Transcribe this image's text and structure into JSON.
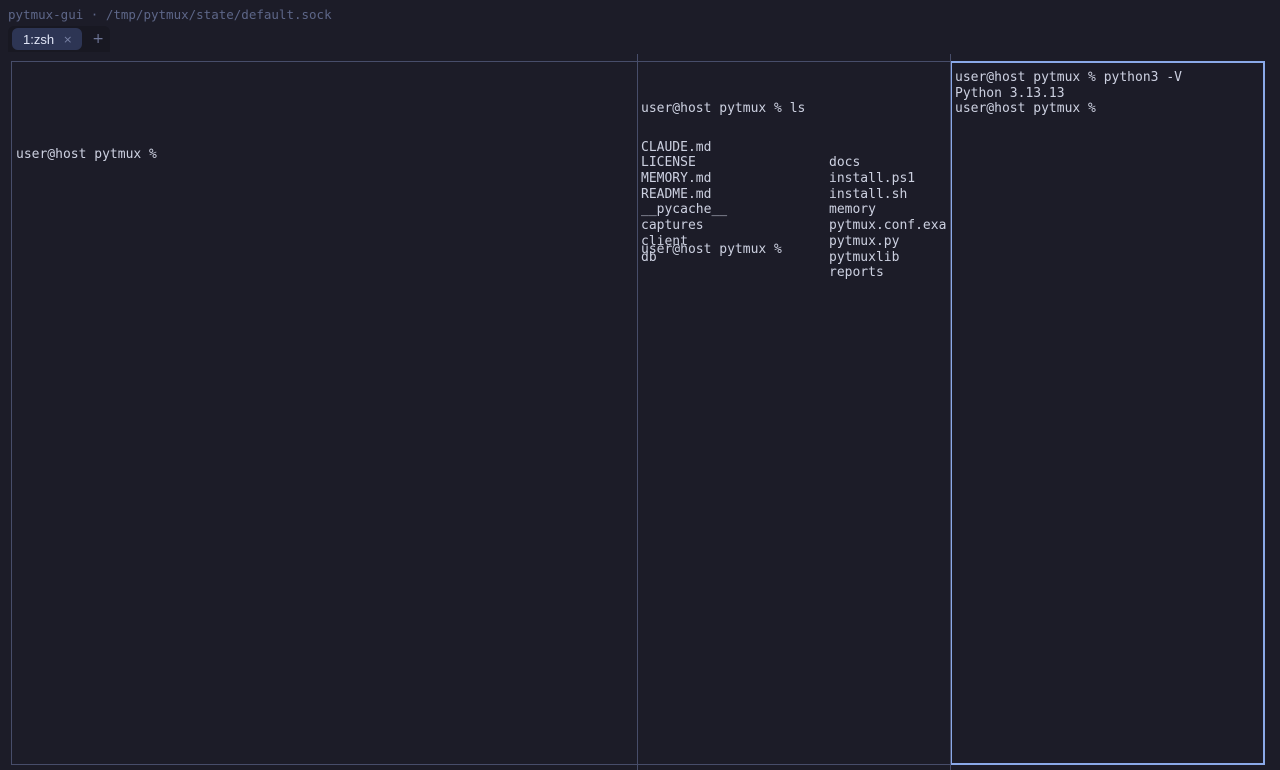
{
  "window": {
    "title": "pytmux-gui · /tmp/pytmux/state/default.sock"
  },
  "tabs": {
    "items": [
      {
        "label": "1:zsh",
        "close": "×",
        "active": true
      }
    ],
    "add_label": "+"
  },
  "panes": {
    "left": {
      "prompt": "user@host pytmux % "
    },
    "middle": {
      "command_line": "user@host pytmux % ls",
      "ls_rows": [
        [
          "CLAUDE.md",
          "docs"
        ],
        [
          "LICENSE",
          "install.ps1"
        ],
        [
          "MEMORY.md",
          "install.sh"
        ],
        [
          "README.md",
          "memory"
        ],
        [
          "__pycache__",
          "pytmux.conf.exa"
        ],
        [
          "captures",
          "pytmux.py"
        ],
        [
          "client",
          "pytmuxlib"
        ],
        [
          "db",
          "reports"
        ]
      ],
      "prompt": "user@host pytmux % "
    },
    "right": {
      "command_line": "user@host pytmux % python3 -V",
      "output": "Python 3.13.13",
      "prompt": "user@host pytmux % ",
      "active": true
    }
  },
  "colors": {
    "background": "#1c1c28",
    "pane_border": "#474d6a",
    "active_pane_border": "#8aa9e8",
    "active_tab": "#2d3554",
    "text": "#ccd0e0",
    "title_text": "#5d6688"
  }
}
